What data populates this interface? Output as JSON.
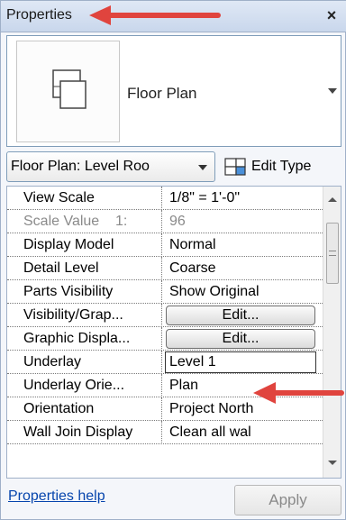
{
  "panel": {
    "title": "Properties",
    "close_glyph": "×"
  },
  "type_selector": {
    "icon": "floor-plan-type-icon",
    "name": "Floor Plan"
  },
  "instance": {
    "selected": "Floor Plan: Level Roo",
    "edit_type_label": "Edit Type",
    "edit_type_icon": "edit-type-icon"
  },
  "properties": [
    {
      "name": "View Scale",
      "value": "1/8\" = 1'-0\"",
      "kind": "text"
    },
    {
      "name": "Scale Value    1:",
      "value": "96",
      "kind": "disabled"
    },
    {
      "name": "Display Model",
      "value": "Normal",
      "kind": "text"
    },
    {
      "name": "Detail Level",
      "value": "Coarse",
      "kind": "text"
    },
    {
      "name": "Parts Visibility",
      "value": "Show Original",
      "kind": "text"
    },
    {
      "name": "Visibility/Grap...",
      "value": "Edit...",
      "kind": "button"
    },
    {
      "name": "Graphic Displa...",
      "value": "Edit...",
      "kind": "button"
    },
    {
      "name": "Underlay",
      "value": "Level 1",
      "kind": "input"
    },
    {
      "name": "Underlay Orie...",
      "value": "Plan",
      "kind": "text"
    },
    {
      "name": "Orientation",
      "value": "Project North",
      "kind": "text"
    },
    {
      "name": "Wall Join Display",
      "value": "Clean all wal",
      "kind": "text"
    }
  ],
  "footer": {
    "help_link": "Properties help",
    "apply_label": "Apply"
  },
  "colors": {
    "annotation_arrow": "#e0443e",
    "link": "#0645ad"
  }
}
